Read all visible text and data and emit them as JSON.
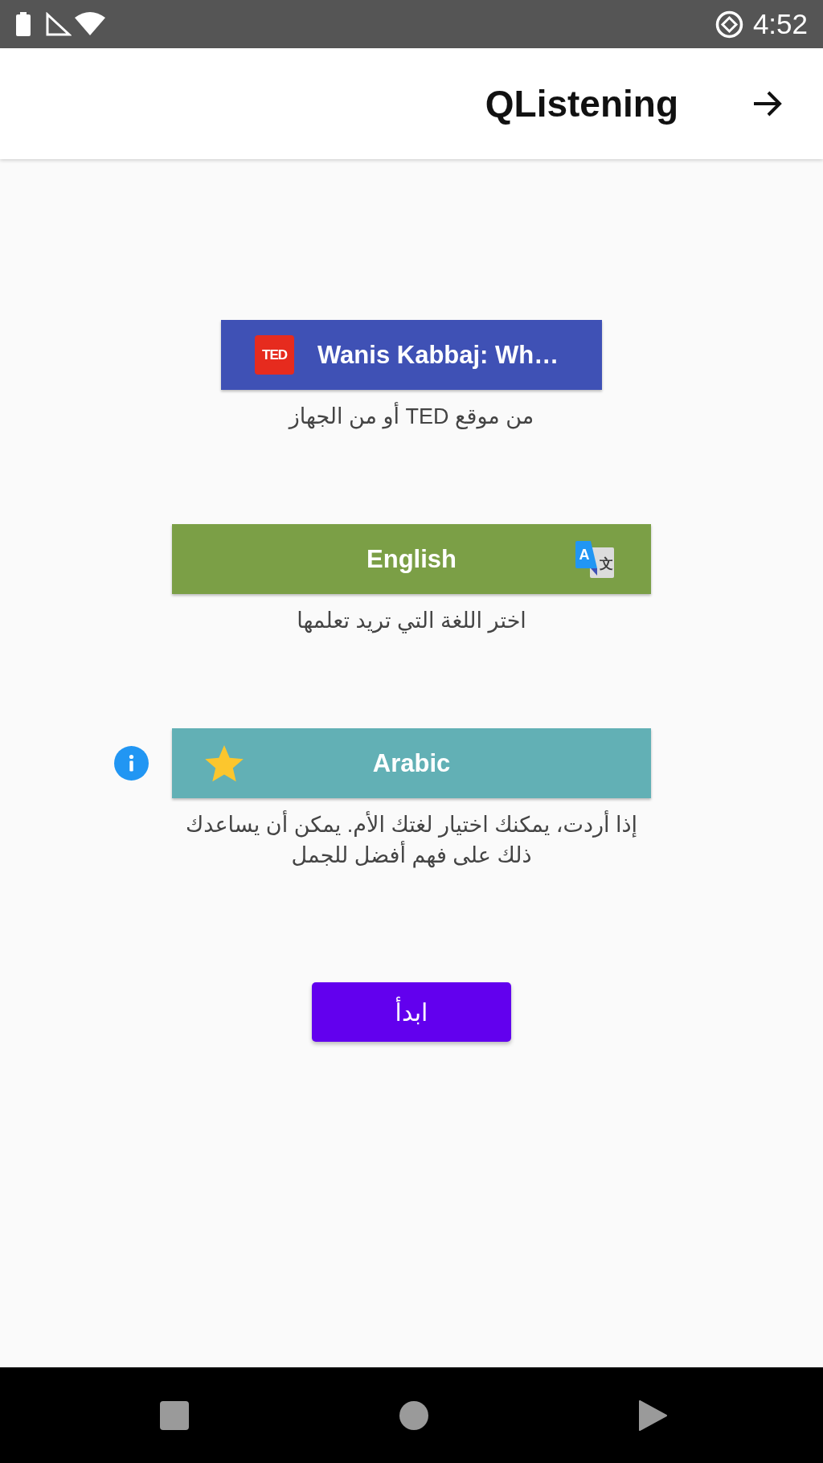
{
  "status_bar": {
    "time": "4:52"
  },
  "app_bar": {
    "title": "QListening"
  },
  "choices": [
    {
      "kind": "source",
      "color": "#3f51b5",
      "logo_text": "TED",
      "label": "Wanis Kabbaj: Wh…",
      "caption": "من موقع TED أو من الجهاز"
    },
    {
      "kind": "learn_language",
      "color": "#7b9f46",
      "icon_letters": [
        "A",
        "文"
      ],
      "label": "English",
      "caption": "اختر اللغة التي تريد تعلمها"
    },
    {
      "kind": "native_language",
      "color": "#62b0b5",
      "label": "Arabic",
      "caption": "إذا أردت، يمكنك اختيار لغتك الأم. يمكن أن يساعدك ذلك على فهم أفضل للجمل"
    }
  ],
  "start_button": {
    "label": "ابدأ"
  }
}
